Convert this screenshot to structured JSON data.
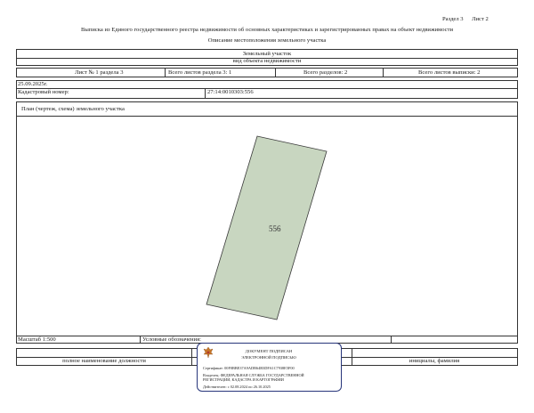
{
  "header": {
    "section_label": "Раздел 3",
    "sheet_label": "Лист 2",
    "title": "Выписка из Единого государственного реестра недвижимости об основных характеристиках и зарегистрированных правах на объект недвижимости",
    "subtitle": "Описание местоположения земельного участка"
  },
  "object": {
    "name": "Земельный участок",
    "kind": "вид объекта недвижимости"
  },
  "sheet_info": {
    "sheet_of_section": "Лист № 1 раздела 3",
    "total_sheets_section": "Всего листов раздела 3: 1",
    "total_sections": "Всего разделов: 2",
    "total_sheets_extract": "Всего листов выписки: 2"
  },
  "meta": {
    "date": "25.09.2025г.",
    "cadastral_label": "Кадастровый номер:",
    "cadastral_value": "27:14:0010303:556"
  },
  "plan": {
    "title": "План (чертеж, схема) земельного участка",
    "parcel_label": "556",
    "parcel_fill": "#c8d6c0",
    "scale_label": "Масштаб 1:500",
    "legend_label": "Условные обозначения:"
  },
  "footer": {
    "position_label": "полное наименование должности",
    "signature_label": "инициалы, фамилия"
  },
  "stamp": {
    "line1": "ДОКУМЕНТ ПОДПИСАН",
    "line2": "ЭЛЕКТРОННОЙ ПОДПИСЬЮ",
    "certificate": "Сертификат: 00F0BBE37A9ADB64B3DFA1C7938E5F00",
    "owner": "Владелец: ФЕДЕРАЛЬНАЯ СЛУЖБА ГОСУДАРСТВЕННОЙ РЕГИСТРАЦИИ, КАДАСТРА И КАРТОГРАФИИ",
    "valid": "Действителен: с 02.08.2024 по 26.10.2025",
    "border_color": "#27357a"
  }
}
